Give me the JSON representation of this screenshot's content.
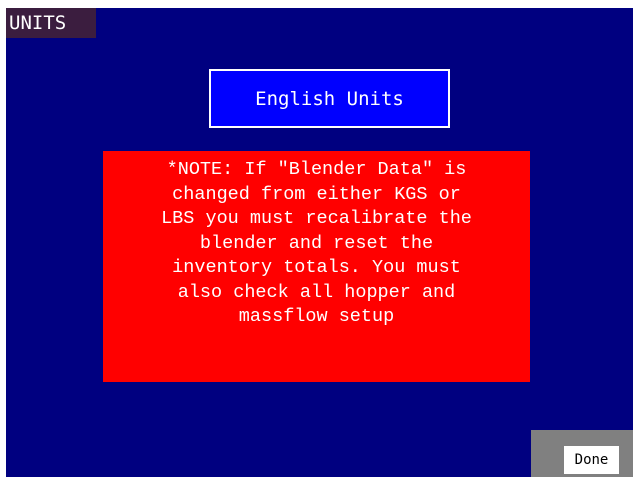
{
  "window": {
    "title": "UNITS"
  },
  "units_button": {
    "label": "English Units"
  },
  "note": {
    "lines": [
      "*NOTE:  If \"Blender Data\" is",
      "changed from either KGS or",
      "LBS you must recalibrate the",
      "blender and reset the",
      "inventory totals.  You must",
      "also check all hopper and",
      "massflow setup"
    ]
  },
  "done_button": {
    "label": "Done"
  },
  "colors": {
    "background": "#000080",
    "title_bg": "#3b1d3f",
    "units_button_bg": "#0000ff",
    "note_bg": "#ff0000",
    "done_area_bg": "#808080",
    "done_button_bg": "#ffffff"
  }
}
